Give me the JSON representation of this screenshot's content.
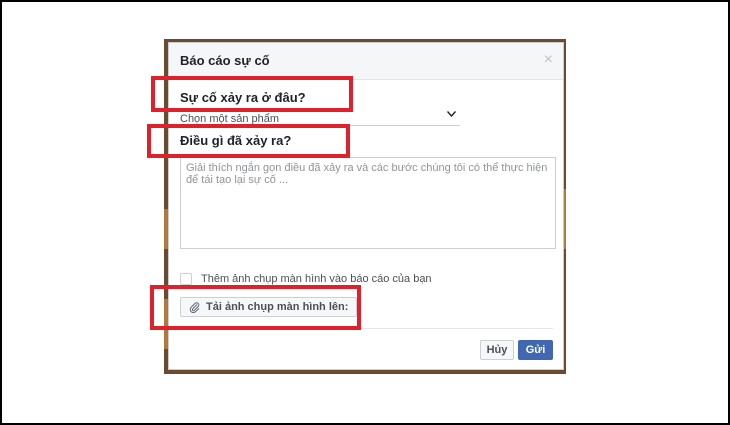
{
  "dialog": {
    "title": "Báo cáo sự cố",
    "close_icon": "×",
    "q1": "Sự cố xảy ra ở đâu?",
    "product_select": {
      "selected": "Chọn một sản phẩm"
    },
    "q2": "Điều gì đã xảy ra?",
    "description": {
      "placeholder": "Giải thích ngắn gọn điều đã xảy ra và các bước chúng tôi có thể thực hiện để tái tạo lại sự cố ..."
    },
    "screenshot_checkbox_label": "Thêm ảnh chụp màn hình vào báo cáo của bạn",
    "upload_label": "Tải ảnh chụp màn hình lên:",
    "cancel_label": "Hủy",
    "send_label": "Gửi"
  },
  "colors": {
    "highlight": "#e0202a",
    "primary": "#4267b2"
  }
}
